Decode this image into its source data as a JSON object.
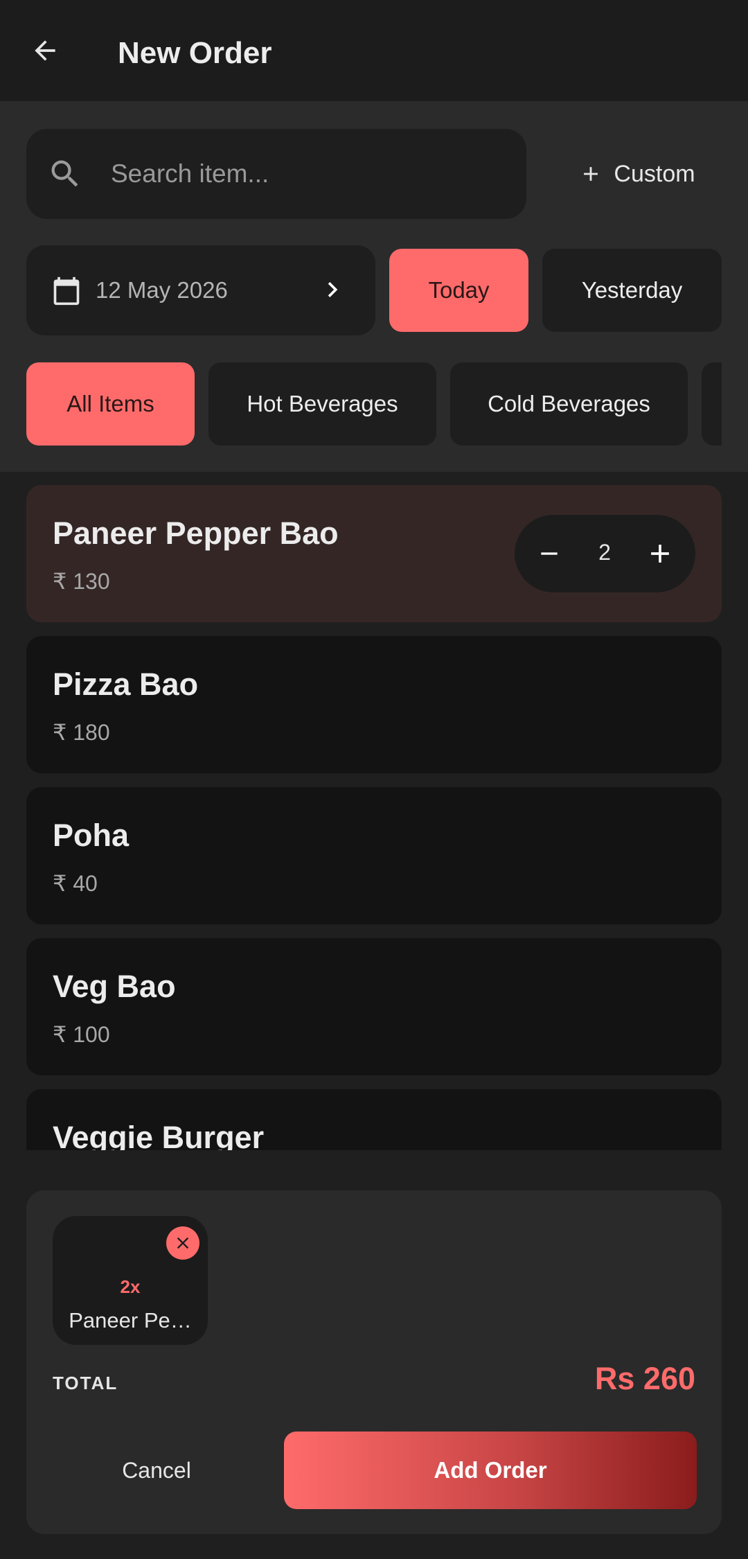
{
  "appbar": {
    "title": "New Order"
  },
  "search": {
    "placeholder": "Search item...",
    "custom_label": "Custom"
  },
  "date": {
    "value": "12 May 2026",
    "today_label": "Today",
    "yesterday_label": "Yesterday"
  },
  "categories": [
    "All Items",
    "Hot Beverages",
    "Cold Beverages"
  ],
  "items": [
    {
      "name": "Paneer Pepper Bao",
      "price": "₹ 130",
      "qty": "2"
    },
    {
      "name": "Pizza Bao",
      "price": "₹ 180"
    },
    {
      "name": "Poha",
      "price": "₹ 40"
    },
    {
      "name": "Veg Bao",
      "price": "₹ 100"
    },
    {
      "name": "Veggie Burger",
      "price": ""
    }
  ],
  "cart": {
    "chip_qty": "2x",
    "chip_name": "Paneer Pe…",
    "total_label": "TOTAL",
    "total_value": "Rs 260",
    "cancel_label": "Cancel",
    "add_label": "Add Order"
  },
  "colors": {
    "accent": "#ff6b6b",
    "background": "#1f1f1f",
    "card": "#131313",
    "selected_card": "#352626"
  }
}
